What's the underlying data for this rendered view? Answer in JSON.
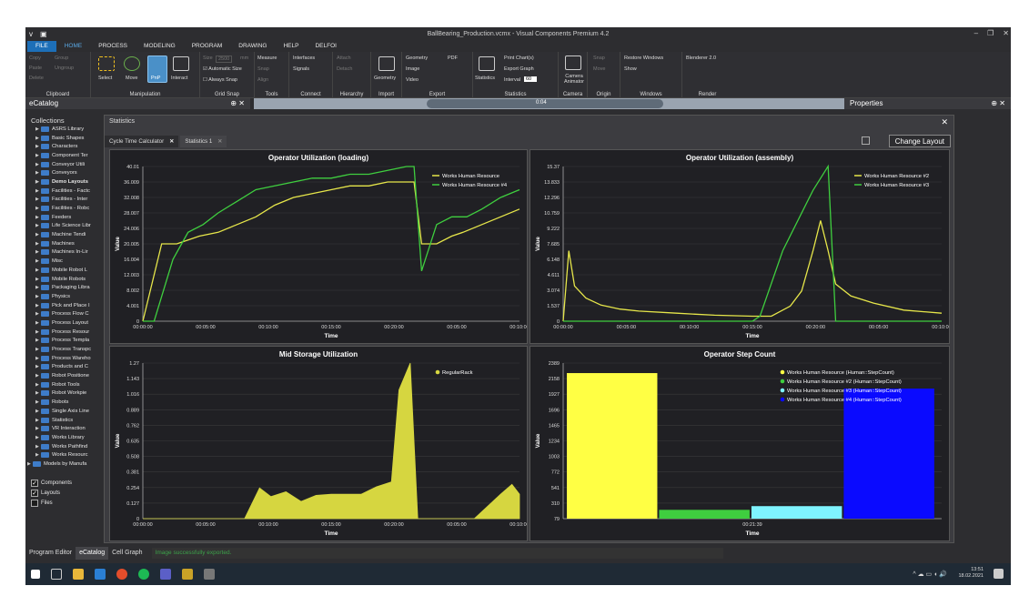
{
  "app": {
    "title": "BallBearing_Production.vcmx - Visual Components Premium 4.2"
  },
  "menu": [
    "FILE",
    "HOME",
    "PROCESS",
    "MODELING",
    "PROGRAM",
    "DRAWING",
    "HELP",
    "DELFOI"
  ],
  "ribbon": {
    "clipboard": {
      "label": "Clipboard",
      "copy": "Copy",
      "paste": "Paste",
      "delete": "Delete",
      "group": "Group",
      "ungroup": "Ungroup"
    },
    "manipulation": {
      "label": "Manipulation",
      "select": "Select",
      "move": "Move",
      "pnp": "PnP",
      "interact": "Interact"
    },
    "gridsnap": {
      "label": "Grid Snap",
      "size": "Size",
      "size_value": "2500",
      "unit": "mm",
      "auto": "Automatic Size",
      "always": "Always Snap",
      "snap": "Snap",
      "align": "Align"
    },
    "tools": {
      "label": "Tools",
      "measure": "Measure",
      "snap": "Snap",
      "align": "Align"
    },
    "connect": {
      "label": "Connect",
      "interfaces": "Interfaces",
      "signals": "Signals"
    },
    "hierarchy": {
      "label": "Hierarchy",
      "attach": "Attach",
      "detach": "Detach"
    },
    "import": {
      "label": "Import",
      "geometry": "Geometry"
    },
    "export": {
      "label": "Export",
      "geometry": "Geometry",
      "pdf": "PDF",
      "image": "Image",
      "video": "Video"
    },
    "statistics": {
      "label": "Statistics",
      "statistics": "Statistics",
      "print": "Print Chart(s)",
      "export_graph": "Export Graph",
      "interval": "Interval",
      "interval_value": "60"
    },
    "camera": {
      "label": "Camera",
      "animator": "Camera Animator"
    },
    "origin": {
      "label": "Origin",
      "snap": "Snap",
      "move": "Move"
    },
    "windows": {
      "label": "Windows",
      "restore": "Restore Windows",
      "show": "Show"
    },
    "render": {
      "label": "Render",
      "blenderer": "Blenderer 2.0"
    }
  },
  "ecatalog": {
    "title": "eCatalog",
    "pin": "📌",
    "close": "✕"
  },
  "properties": {
    "title": "Properties"
  },
  "viewport": {
    "time": "0:04"
  },
  "collections": {
    "header": "Collections",
    "items": [
      "ASRS Library",
      "Basic Shapes",
      "Characters",
      "Component Ter",
      "Conveyor Utili",
      "Conveyors",
      "Demo Layouts",
      "Facilities - Factc",
      "Facilities - Inter",
      "Facilities - Robc",
      "Feeders",
      "Life Science Libr",
      "Machine Tendi",
      "Machines",
      "Machines In-Lir",
      "Misc",
      "Mobile Robot L",
      "Mobile Robots",
      "Packaging Libra",
      "Physics",
      "Pick and Place I",
      "Process Flow C",
      "Process Layout",
      "Process Resour",
      "Process Templa",
      "Process Transpc",
      "Process Wareho",
      "Products and C",
      "Robot Positione",
      "Robot Tools",
      "Robot Workpie",
      "Robots",
      "Single Axis Line",
      "Statistics",
      "VR Interaction",
      "Works Library",
      "Works Pathfind",
      "Works Resourc",
      "Models by Manufa"
    ],
    "bold_index": 6
  },
  "filters": [
    {
      "label": "Components",
      "checked": true
    },
    {
      "label": "Layouts",
      "checked": true
    },
    {
      "label": "Files",
      "checked": false
    }
  ],
  "statistics": {
    "title": "Statistics",
    "tabs": [
      {
        "label": "Cycle Time Calculator",
        "close": "✕"
      },
      {
        "label": "Statistics 1",
        "close": "✕"
      }
    ],
    "change_layout": "Change Layout"
  },
  "status": {
    "tabs": [
      "Program Editor",
      "eCatalog",
      "Cell Graph"
    ],
    "message": "Image successfully exported."
  },
  "taskbar": {
    "time": "13:51",
    "date": "18.02.2021"
  },
  "colors": {
    "yellow": "#e6e64a",
    "green": "#3fce3f",
    "cyan": "#7ff4ff",
    "blue": "#0a0aff",
    "mid": "#d6d640",
    "stepyellow": "#ffff44"
  },
  "chart_data": [
    {
      "type": "line",
      "title": "Operator Utilization (loading)",
      "xlabel": "Time",
      "ylabel": "Value",
      "yticks": [
        "0",
        "4.001",
        "8.002",
        "12.003",
        "16.004",
        "20.005",
        "24.006",
        "28.007",
        "32.008",
        "36.009",
        "40.01"
      ],
      "ylim": [
        0,
        40.01
      ],
      "xticks": [
        "00:00:00",
        "00:05:00",
        "00:10:00",
        "00:15:00",
        "00:20:00",
        "00:05:00",
        "00:10:00"
      ],
      "series": [
        {
          "name": "Works Human Resource",
          "color": "#e6e64a",
          "points": [
            [
              0,
              0
            ],
            [
              0.05,
              20
            ],
            [
              0.09,
              20
            ],
            [
              0.12,
              21
            ],
            [
              0.15,
              22
            ],
            [
              0.2,
              23
            ],
            [
              0.25,
              25
            ],
            [
              0.3,
              27
            ],
            [
              0.35,
              30
            ],
            [
              0.4,
              32
            ],
            [
              0.45,
              33
            ],
            [
              0.5,
              34
            ],
            [
              0.55,
              35
            ],
            [
              0.6,
              35
            ],
            [
              0.65,
              36
            ],
            [
              0.7,
              36
            ],
            [
              0.72,
              36
            ],
            [
              0.74,
              20
            ],
            [
              0.78,
              20
            ],
            [
              0.82,
              22
            ],
            [
              0.85,
              23
            ],
            [
              0.9,
              25
            ],
            [
              0.95,
              27
            ],
            [
              1,
              29
            ]
          ]
        },
        {
          "name": "Works Human Resource #4",
          "color": "#3fce3f",
          "points": [
            [
              0,
              0
            ],
            [
              0.03,
              0
            ],
            [
              0.08,
              16
            ],
            [
              0.12,
              23
            ],
            [
              0.16,
              25
            ],
            [
              0.2,
              28
            ],
            [
              0.25,
              31
            ],
            [
              0.3,
              34
            ],
            [
              0.35,
              35
            ],
            [
              0.4,
              36
            ],
            [
              0.45,
              37
            ],
            [
              0.5,
              37
            ],
            [
              0.55,
              38
            ],
            [
              0.6,
              38
            ],
            [
              0.65,
              39
            ],
            [
              0.7,
              40
            ],
            [
              0.72,
              40
            ],
            [
              0.74,
              13
            ],
            [
              0.78,
              25
            ],
            [
              0.82,
              27
            ],
            [
              0.86,
              27
            ],
            [
              0.9,
              29
            ],
            [
              0.95,
              32
            ],
            [
              1,
              34
            ]
          ]
        }
      ]
    },
    {
      "type": "line",
      "title": "Operator Utilization (assembly)",
      "xlabel": "Time",
      "ylabel": "Value",
      "yticks": [
        "0",
        "1.537",
        "3.074",
        "4.611",
        "6.148",
        "7.685",
        "9.222",
        "10.759",
        "12.296",
        "13.833",
        "15.37"
      ],
      "ylim": [
        0,
        15.37
      ],
      "xticks": [
        "00:00:00",
        "00:05:00",
        "00:10:00",
        "00:15:00",
        "00:20:00",
        "00:05:00",
        "00:10:00"
      ],
      "series": [
        {
          "name": "Works Human Resource #2",
          "color": "#e6e64a",
          "points": [
            [
              0,
              0
            ],
            [
              0.015,
              7
            ],
            [
              0.03,
              3.5
            ],
            [
              0.06,
              2.3
            ],
            [
              0.1,
              1.6
            ],
            [
              0.15,
              1.2
            ],
            [
              0.2,
              1
            ],
            [
              0.3,
              0.8
            ],
            [
              0.4,
              0.6
            ],
            [
              0.5,
              0.5
            ],
            [
              0.55,
              0.5
            ],
            [
              0.6,
              1.5
            ],
            [
              0.63,
              3
            ],
            [
              0.66,
              7
            ],
            [
              0.68,
              10
            ],
            [
              0.7,
              7
            ],
            [
              0.72,
              3.7
            ],
            [
              0.76,
              2.5
            ],
            [
              0.82,
              1.8
            ],
            [
              0.9,
              1.1
            ],
            [
              1,
              0.8
            ]
          ]
        },
        {
          "name": "Works Human Resource #3",
          "color": "#3fce3f",
          "points": [
            [
              0,
              0
            ],
            [
              0.5,
              0
            ],
            [
              0.52,
              0.5
            ],
            [
              0.58,
              7
            ],
            [
              0.62,
              10
            ],
            [
              0.66,
              13
            ],
            [
              0.7,
              15.4
            ],
            [
              0.72,
              0
            ],
            [
              1,
              0
            ]
          ]
        }
      ]
    },
    {
      "type": "area",
      "title": "Mid Storage Utilization",
      "xlabel": "Time",
      "ylabel": "Value",
      "yticks": [
        "0",
        "0.127",
        "0.254",
        "0.381",
        "0.508",
        "0.635",
        "0.762",
        "0.889",
        "1.016",
        "1.143",
        "1.27"
      ],
      "ylim": [
        0,
        1.27
      ],
      "xticks": [
        "00:00:00",
        "00:05:00",
        "00:10:00",
        "00:15:00",
        "00:20:00",
        "00:05:00",
        "00:10:00"
      ],
      "series": [
        {
          "name": "RegularRack",
          "color": "#d6d640",
          "points": [
            [
              0,
              0
            ],
            [
              0.27,
              0
            ],
            [
              0.31,
              0.25
            ],
            [
              0.34,
              0.18
            ],
            [
              0.38,
              0.22
            ],
            [
              0.42,
              0.14
            ],
            [
              0.46,
              0.19
            ],
            [
              0.5,
              0.2
            ],
            [
              0.54,
              0.2
            ],
            [
              0.58,
              0.2
            ],
            [
              0.62,
              0.26
            ],
            [
              0.66,
              0.3
            ],
            [
              0.68,
              1.05
            ],
            [
              0.71,
              1.27
            ],
            [
              0.73,
              0
            ],
            [
              0.88,
              0
            ],
            [
              0.95,
              0.2
            ],
            [
              0.98,
              0.28
            ],
            [
              1,
              0.2
            ]
          ]
        }
      ]
    },
    {
      "type": "bar",
      "title": "Operator Step Count",
      "xlabel": "Time",
      "ylabel": "Value",
      "yticks": [
        "79",
        "310",
        "541",
        "772",
        "1003",
        "1234",
        "1465",
        "1696",
        "1927",
        "2158",
        "2389"
      ],
      "ylim": [
        79,
        2389
      ],
      "xticks": [
        "00:21:39"
      ],
      "series": [
        {
          "name": "Works Human Resource (Human::StepCount)",
          "color": "#ffff44",
          "value": 2240
        },
        {
          "name": "Works Human Resource #2 (Human::StepCount)",
          "color": "#3fce3f",
          "value": 210
        },
        {
          "name": "Works Human Resource #3 (Human::StepCount)",
          "color": "#7ff4ff",
          "value": 265
        },
        {
          "name": "Works Human Resource #4 (Human::StepCount)",
          "color": "#0a0aff",
          "value": 2010
        }
      ]
    }
  ]
}
